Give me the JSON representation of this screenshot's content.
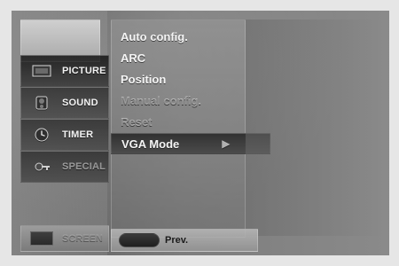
{
  "left_menu": {
    "items": [
      {
        "label": "PICTURE",
        "icon": "picture-icon"
      },
      {
        "label": "SOUND",
        "icon": "speaker-icon"
      },
      {
        "label": "TIMER",
        "icon": "clock-icon"
      },
      {
        "label": "SPECIAL",
        "icon": "key-icon"
      }
    ],
    "bottom_item": {
      "label": "SCREEN",
      "icon": "screen-icon"
    }
  },
  "main_menu": {
    "items": [
      {
        "label": "Auto config."
      },
      {
        "label": "ARC"
      },
      {
        "label": "Position"
      },
      {
        "label": "Manual config."
      },
      {
        "label": "Reset"
      },
      {
        "label": "VGA Mode",
        "submenu_indicator": "▶"
      }
    ]
  },
  "footer": {
    "prev_label": "Prev."
  }
}
